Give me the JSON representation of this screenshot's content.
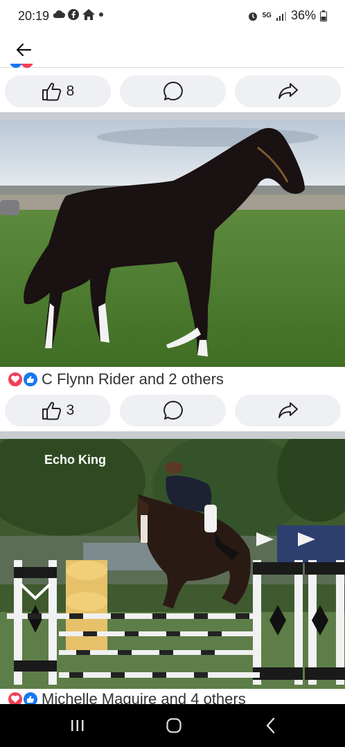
{
  "status": {
    "time": "20:19",
    "network": "5G",
    "battery": "36%"
  },
  "posts": [
    {
      "like_count": "8"
    },
    {
      "reactions_text": "C Flynn Rider and 2 others",
      "like_count": "3"
    },
    {
      "overlay_label": "Echo King",
      "reactions_text": "Michelle Maguire and 4 others"
    }
  ],
  "colors": {
    "like_blue": "#1877f2",
    "love_red": "#f33e58",
    "pill_bg": "#eef0f3"
  },
  "icons": [
    "cloud-icon",
    "facebook-icon",
    "home-icon",
    "alarm-icon",
    "signal-icon",
    "battery-icon",
    "back-arrow-icon",
    "thumbs-up-icon",
    "comment-icon",
    "share-icon",
    "recents-icon",
    "home-circle-icon",
    "back-chevron-icon"
  ]
}
